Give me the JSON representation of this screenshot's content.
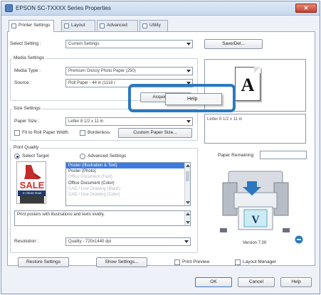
{
  "window": {
    "title": "EPSON SC-TXXXX Series Properties",
    "close_label": "✕"
  },
  "tabs": [
    {
      "label": "Printer Settings",
      "icon": "printer-icon"
    },
    {
      "label": "Layout",
      "icon": "layout-icon"
    },
    {
      "label": "Advanced",
      "icon": "advanced-icon"
    },
    {
      "label": "Utility",
      "icon": "utility-icon"
    }
  ],
  "select_setting": {
    "label": "Select Setting :",
    "value": "Current Settings",
    "save_del_label": "Save/Del..."
  },
  "media_settings": {
    "group_title": "Media Settings",
    "media_type_label": "Media Type :",
    "media_type_value": "Premium Glossy Photo Paper (250)",
    "source_label": "Source :",
    "source_value": "Roll Paper - 44 in (1118 r",
    "acquire_label": "Acquire Se..."
  },
  "context_menu": {
    "help_label": "Help"
  },
  "size_settings": {
    "group_title": "Size Settings",
    "paper_size_label": "Paper Size :",
    "paper_size_value": "Letter 8 1/2 x 11 in",
    "fit_to_roll_label": "Fit to Roll Paper Width",
    "borderless_label": "Borderless",
    "custom_paper_label": "Custom Paper Size..."
  },
  "print_quality": {
    "group_title": "Print Quality",
    "select_target_label": "Select Target",
    "advanced_settings_label": "Advanced Settings",
    "targets": [
      {
        "label": "Poster (Illustration & Text)",
        "state": "selected"
      },
      {
        "label": "Poster (Photo)",
        "state": "normal"
      },
      {
        "label": "Office Document (Fast)",
        "state": "dim"
      },
      {
        "label": "Office Document (Color)",
        "state": "normal"
      },
      {
        "label": "CAD / Line Drawing (Black)",
        "state": "dim"
      },
      {
        "label": "CAD / Line Drawing (Color)",
        "state": "dim"
      }
    ],
    "description": "Print posters with illustrations and texts vividly.",
    "resolution_label": "Resolution :",
    "resolution_value": "Quality - 720x1440 dpi",
    "sale_text": "SALE",
    "in_store_text": "In Store Now"
  },
  "preview": {
    "paper_letter": "A",
    "paper_size_text": "Letter 8 1/2 x 11 in",
    "paper_remaining_label": "Paper Remaining",
    "version_label": "Version 7.00"
  },
  "footer": {
    "restore_label": "Restore Settings",
    "show_settings_label": "Show Settings...",
    "print_preview_label": "Print Preview",
    "layout_manager_label": "Layout Manager",
    "ok_label": "OK",
    "cancel_label": "Cancel",
    "help_label": "Help"
  },
  "colors": {
    "accent_blue": "#2a79c0",
    "selection_blue": "#3d7be0",
    "sale_red": "#d0312d"
  }
}
